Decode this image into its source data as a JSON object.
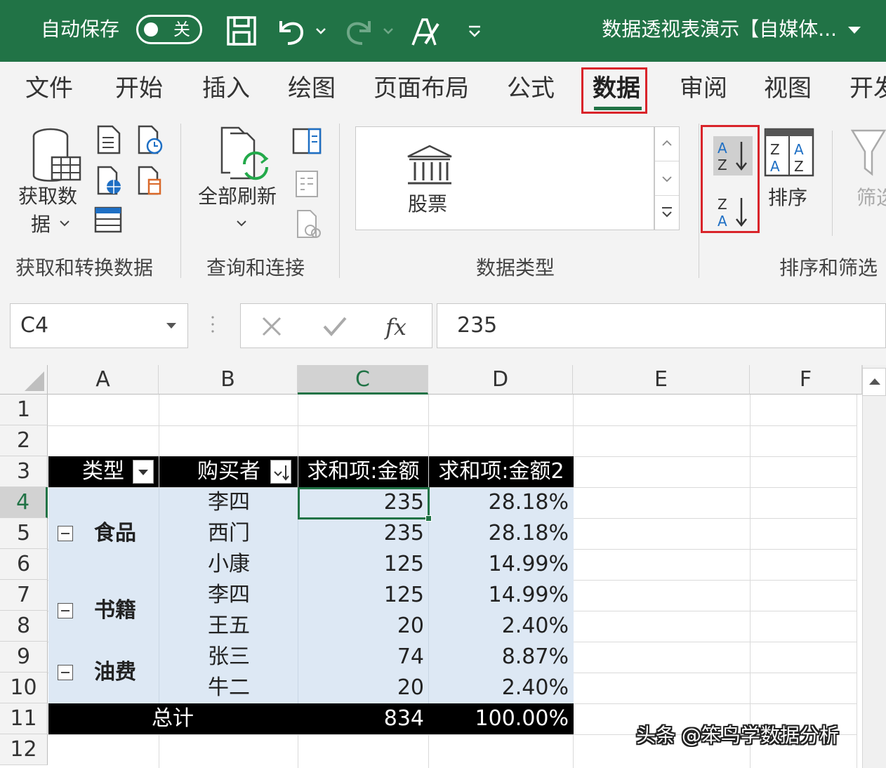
{
  "titlebar": {
    "autosave_label": "自动保存",
    "autosave_state": "关",
    "document_title": "数据透视表演示【自媒体...",
    "qat_icons": [
      "save-icon",
      "undo-icon",
      "redo-icon",
      "format-painter-icon",
      "customize-qat-icon"
    ]
  },
  "tabs": [
    {
      "label": "文件"
    },
    {
      "label": "开始"
    },
    {
      "label": "插入"
    },
    {
      "label": "绘图"
    },
    {
      "label": "页面布局"
    },
    {
      "label": "公式"
    },
    {
      "label": "数据",
      "active": true
    },
    {
      "label": "审阅"
    },
    {
      "label": "视图"
    },
    {
      "label": "开发"
    }
  ],
  "ribbon": {
    "get_data_label": "获取数",
    "get_data_label2": "据",
    "group1": "获取和转换数据",
    "refresh_all": "全部刷新",
    "group2": "查询和连接",
    "stocks": "股票",
    "group3": "数据类型",
    "sort": "排序",
    "filter": "筛选",
    "group4": "排序和筛选"
  },
  "formula_bar": {
    "name_box": "C4",
    "value": "235"
  },
  "columns": [
    "A",
    "B",
    "C",
    "D",
    "E",
    "F"
  ],
  "rows": [
    "1",
    "2",
    "3",
    "4",
    "5",
    "6",
    "7",
    "8",
    "9",
    "10",
    "11",
    "12"
  ],
  "pivot": {
    "header": [
      "类型",
      "购买者",
      "求和项:金额",
      "求和项:金额2"
    ],
    "groups": [
      {
        "name": "食品",
        "rows": [
          {
            "buyer": "李四",
            "amount": "235",
            "pct": "28.18%"
          },
          {
            "buyer": "西门",
            "amount": "235",
            "pct": "28.18%"
          },
          {
            "buyer": "小康",
            "amount": "125",
            "pct": "14.99%"
          }
        ]
      },
      {
        "name": "书籍",
        "rows": [
          {
            "buyer": "李四",
            "amount": "125",
            "pct": "14.99%"
          },
          {
            "buyer": "王五",
            "amount": "20",
            "pct": "2.40%"
          }
        ]
      },
      {
        "name": "油费",
        "rows": [
          {
            "buyer": "张三",
            "amount": "74",
            "pct": "8.87%"
          },
          {
            "buyer": "牛二",
            "amount": "20",
            "pct": "2.40%"
          }
        ]
      }
    ],
    "total": {
      "label": "总计",
      "amount": "834",
      "pct": "100.00%"
    }
  },
  "watermark": "头条 @笨鸟学数据分析",
  "colors": {
    "excel_green": "#217346",
    "highlight_red": "#d9242a",
    "pivot_body": "#dde8f4"
  }
}
